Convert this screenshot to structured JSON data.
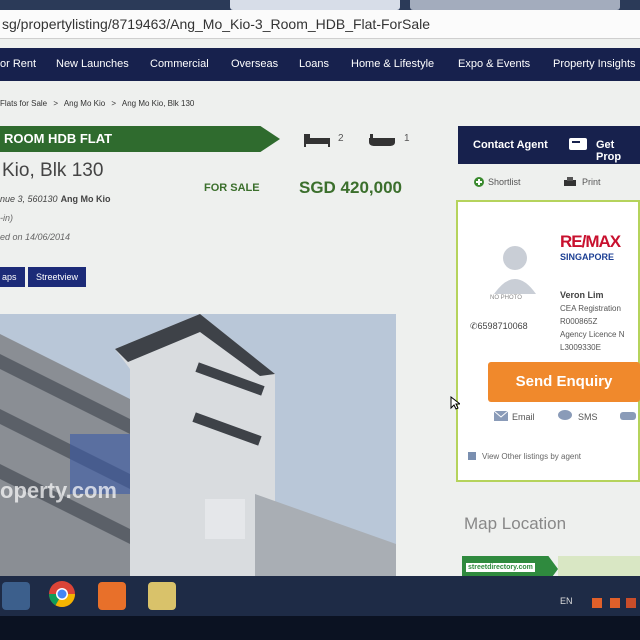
{
  "browser": {
    "url": "sg/propertylisting/8719463/Ang_Mo_Kio-3_Room_HDB_Flat-ForSale"
  },
  "nav": {
    "items": [
      "or Rent",
      "New Launches",
      "Commercial",
      "Overseas",
      "Loans",
      "Home & Lifestyle",
      "Expo & Events",
      "Property Insights"
    ]
  },
  "breadcrumb": [
    "Flats for Sale",
    ">",
    "Ang Mo Kio",
    ">",
    "Ang Mo Kio, Blk 130"
  ],
  "listing": {
    "type_label": "ROOM HDB FLAT",
    "bedrooms": "2",
    "bathrooms": "1",
    "title": "Kio, Blk 130",
    "status": "FOR SALE",
    "price": "SGD 420,000",
    "address": "nue 3, 560130",
    "district": "Ang Mo Kio",
    "note": "-in)",
    "listed": "ed on 14/06/2014",
    "maps_label": "aps",
    "streetview_label": "Streetview",
    "watermark": "operty.com"
  },
  "sidebar": {
    "contact_label": "Contact Agent",
    "get_label": "Get Prop",
    "shortlist_label": "Shortlist",
    "print_label": "Print",
    "no_photo_label": "NO PHOTO",
    "phone": "6598710068",
    "brand": "RE/MAX",
    "brand_sub": "SINGAPORE",
    "agent_name": "Veron Lim",
    "agent_lines": [
      "CEA Registration",
      "R000865Z",
      "Agency Licence N",
      "L3009330E"
    ],
    "enquiry_label": "Send Enquiry",
    "email_label": "Email",
    "sms_label": "SMS",
    "other_listings": "View Other listings by agent",
    "map_heading": "Map Location",
    "streetdirectory": "streetdirectory.com"
  },
  "taskbar": {
    "tray": "EN"
  },
  "colors": {
    "nav_bg": "#17214d",
    "green": "#2f6b2e",
    "price_green": "#3b6f2c",
    "enquiry_orange": "#f0892c",
    "agent_border": "#b5d35c"
  }
}
